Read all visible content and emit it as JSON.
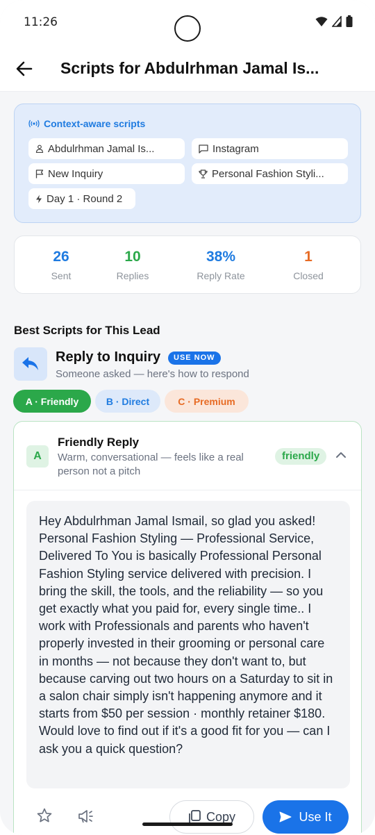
{
  "status_bar": {
    "time": "11:26"
  },
  "app_bar": {
    "title": "Scripts for Abdulrhman Jamal Is..."
  },
  "context": {
    "heading": "Context-aware scripts",
    "chips": {
      "lead_name": "Abdulrhman Jamal Is...",
      "channel": "Instagram",
      "stage": "New Inquiry",
      "service": "Personal Fashion Styli...",
      "timing": "Day 1 · Round 2"
    }
  },
  "stats": [
    {
      "value": "26",
      "label": "Sent",
      "color": "#1f7be0"
    },
    {
      "value": "10",
      "label": "Replies",
      "color": "#2ba84a"
    },
    {
      "value": "38%",
      "label": "Reply Rate",
      "color": "#1f7be0"
    },
    {
      "value": "1",
      "label": "Closed",
      "color": "#e76b24"
    }
  ],
  "section_title": "Best Scripts for This Lead",
  "scenario": {
    "title": "Reply to Inquiry",
    "badge": "USE NOW",
    "subtitle": "Someone asked — here's how to respond"
  },
  "tabs": [
    "A · Friendly",
    "B · Direct",
    "C · Premium"
  ],
  "script": {
    "letter": "A",
    "title": "Friendly Reply",
    "description": "Warm, conversational — feels like a real person not a pitch",
    "tone": "friendly",
    "body": "Hey Abdulrhman Jamal Ismail, so glad you asked! Personal Fashion Styling — Professional Service, Delivered To You is basically Professional Personal Fashion Styling service delivered with precision. I bring the skill, the tools, and the reliability — so you get exactly what you paid for, every single time.. I work with Professionals and parents who haven't properly invested in their grooming or personal care in months — not because they don't want to, but because carving out two hours on a Saturday to sit in a salon chair simply isn't happening anymore and it starts from $50 per session · monthly retainer $180. Would love to find out if it's a good fit for you — can I ask you a quick question?"
  },
  "actions": {
    "copy": "Copy",
    "use": "Use It"
  },
  "colors": {
    "accent": "#1a73e8",
    "green": "#2ba84a",
    "orange": "#e76b24"
  }
}
